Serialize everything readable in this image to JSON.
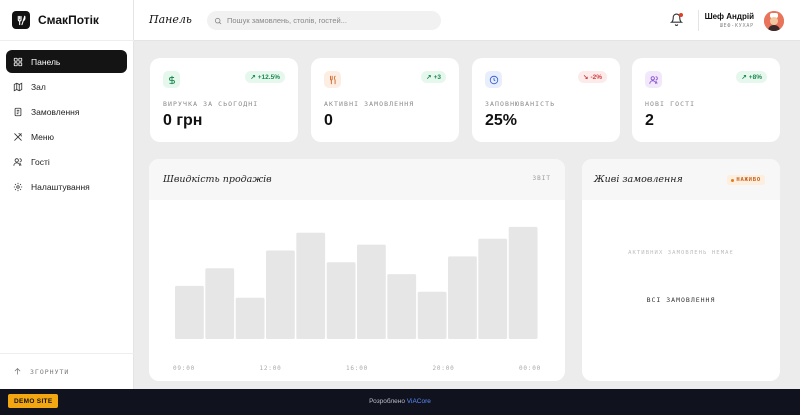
{
  "app": {
    "name": "СмакПотік"
  },
  "sidebar": {
    "items": [
      {
        "label": "Панель",
        "icon": "dashboard-icon",
        "active": true
      },
      {
        "label": "Зал",
        "icon": "map-icon",
        "active": false
      },
      {
        "label": "Замовлення",
        "icon": "orders-icon",
        "active": false
      },
      {
        "label": "Меню",
        "icon": "utensils-icon",
        "active": false
      },
      {
        "label": "Гості",
        "icon": "users-icon",
        "active": false
      },
      {
        "label": "Налаштування",
        "icon": "gear-icon",
        "active": false
      }
    ],
    "collapse_label": "ЗГОРНУТИ"
  },
  "header": {
    "title": "Панель",
    "search_placeholder": "Пошук замовлень, столів, гостей...",
    "user": {
      "name": "Шеф Андрій",
      "role": "ШЕФ-КУХАР"
    }
  },
  "stats": [
    {
      "label": "ВИРУЧКА ЗА СЬОГОДНІ",
      "value": "0 грн",
      "change": "+12.5%",
      "trend": "up",
      "icon": "dollar-icon",
      "color": "#1a8a4d",
      "bg": "#e6f7ee"
    },
    {
      "label": "АКТИВНІ ЗАМОВЛЕННЯ",
      "value": "0",
      "change": "+3",
      "trend": "up",
      "icon": "utensils-icon",
      "color": "#d0652a",
      "bg": "#fdeee3"
    },
    {
      "label": "ЗАПОВНЮВАНІСТЬ",
      "value": "25%",
      "change": "-2%",
      "trend": "down",
      "icon": "clock-icon",
      "color": "#3a64d8",
      "bg": "#e8eefc"
    },
    {
      "label": "НОВІ ГОСТІ",
      "value": "2",
      "change": "+8%",
      "trend": "up",
      "icon": "users-icon",
      "color": "#8a4fd0",
      "bg": "#f1e9fb"
    }
  ],
  "sales_chart": {
    "title": "Швидкість продажів",
    "meta": "ЗВІТ"
  },
  "chart_data": {
    "type": "bar",
    "title": "Швидкість продажів",
    "tick_labels": [
      "09:00",
      "12:00",
      "16:00",
      "20:00",
      "00:00"
    ],
    "values": [
      45,
      60,
      35,
      75,
      90,
      65,
      80,
      55,
      40,
      70,
      85,
      95
    ],
    "ylim": [
      0,
      100
    ]
  },
  "live_orders": {
    "title": "Живі замовлення",
    "badge": "НАЖИВО",
    "empty_text": "АКТИВНИХ ЗАМОВЛЕНЬ НЕМАЄ",
    "all_label": "ВСІ ЗАМОВЛЕННЯ"
  },
  "footer": {
    "demo_label": "DEMO SITE",
    "credit_prefix": "Розроблено",
    "credit_link": "ViACore"
  }
}
